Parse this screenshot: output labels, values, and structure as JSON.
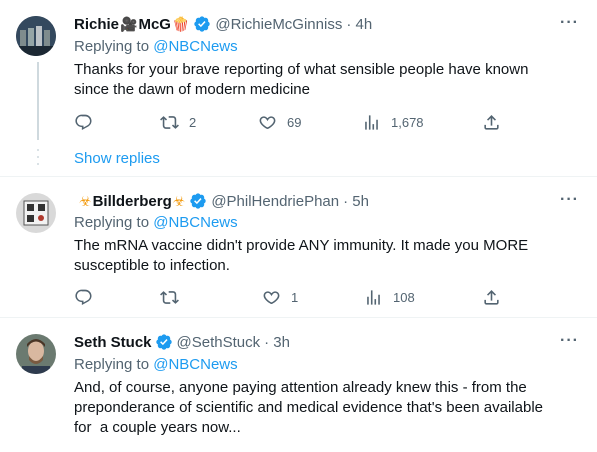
{
  "tweets": [
    {
      "display_name": "Richie",
      "name_suffix": "McG",
      "emoji_1": "🎥",
      "emoji_2": "🍿",
      "handle": "@RichieMcGinniss",
      "time": "· 4h",
      "replying_label": "Replying to",
      "replying_to": "@NBCNews",
      "text_line1": "Thanks for your brave reporting of what sensible people have known",
      "text_line2": "since the dawn of modern medicine",
      "replies": "",
      "retweets": "2",
      "likes": "69",
      "views": "1,678"
    },
    {
      "display_name": "Billderberg",
      "emoji_1": "☣",
      "emoji_2": "☣",
      "handle": "@PhilHendriePhan",
      "time": "· 5h",
      "replying_label": "Replying to",
      "replying_to": "@NBCNews",
      "text_line1": "The mRNA vaccine didn't provide ANY immunity. It made you MORE",
      "text_line2": "susceptible to infection.",
      "replies": "",
      "retweets": "",
      "likes": "1",
      "views": "108"
    },
    {
      "display_name": "Seth Stuck",
      "handle": "@SethStuck",
      "time": "· 3h",
      "replying_label": "Replying to",
      "replying_to": "@NBCNews",
      "text_line1": "And, of course, anyone paying attention already knew this - from the",
      "text_line2": "preponderance of scientific and medical evidence that's been available",
      "text_line3": "for  a couple years now..."
    }
  ],
  "show_replies": "Show replies",
  "more_glyph": "···",
  "colors": {
    "accent": "#1d9bf0",
    "muted": "#536471",
    "text": "#0f1419",
    "border": "#eff3f4"
  }
}
